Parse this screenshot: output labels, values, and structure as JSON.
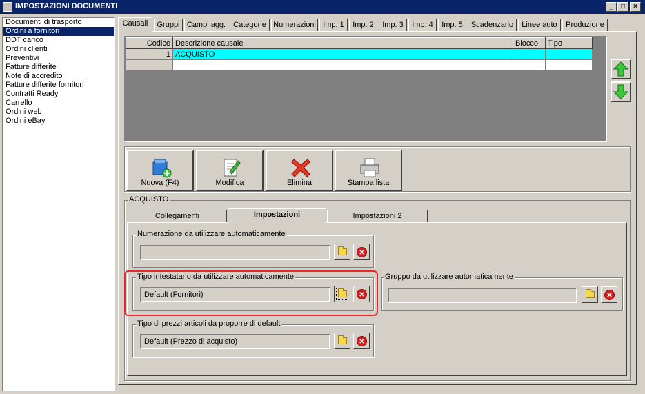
{
  "window": {
    "title": "IMPOSTAZIONI DOCUMENTI"
  },
  "sidebar": {
    "items": [
      {
        "label": "Documenti di trasporto"
      },
      {
        "label": "Ordini a fornitori"
      },
      {
        "label": "DDT carico"
      },
      {
        "label": "Ordini clienti"
      },
      {
        "label": "Preventivi"
      },
      {
        "label": "Fatture differite"
      },
      {
        "label": "Note di accredito"
      },
      {
        "label": "Fatture differite fornitori"
      },
      {
        "label": "Contratti Ready"
      },
      {
        "label": "Carrello"
      },
      {
        "label": "Ordini web"
      },
      {
        "label": "Ordini eBay"
      }
    ],
    "selected": "Ordini a fornitori"
  },
  "tabs": [
    "Causali",
    "Gruppi",
    "Campi agg.",
    "Categorie",
    "Numerazioni",
    "Imp. 1",
    "Imp. 2",
    "Imp. 3",
    "Imp. 4",
    "Imp. 5",
    "Scadenzario",
    "Linee auto",
    "Produzione"
  ],
  "grid": {
    "headers": {
      "codice": "Codice",
      "descrizione": "Descrizione causale",
      "blocco": "Blocco",
      "tipo": "Tipo"
    },
    "rows": [
      {
        "codice": "1",
        "descrizione": "ACQUISTO",
        "blocco": "",
        "tipo": ""
      }
    ]
  },
  "toolbar": {
    "nuova": "Nuova (F4)",
    "modifica": "Modifica",
    "elimina": "Elimina",
    "stampa": "Stampa lista"
  },
  "section": {
    "title": "ACQUISTO",
    "subtabs": [
      "Collegamenti",
      "Impostazioni",
      "Impostazioni 2"
    ],
    "numerazione": {
      "label": "Numerazione da utilizzare automaticamente",
      "value": ""
    },
    "tipo_intestatario": {
      "label": "Tipo intestatario da utilizzare automaticamente",
      "value": "Default (Fornitori)"
    },
    "gruppo": {
      "label": "Gruppo da utilizzare automaticamente",
      "value": ""
    },
    "tipo_prezzi": {
      "label": "Tipo di prezzi articoli da proporre di default",
      "value": "Default (Prezzo di acquisto)"
    }
  },
  "colors": {
    "title_bg": "#0a246a",
    "row_selected": "#00ffff",
    "highlight_border": "#e8262b"
  }
}
